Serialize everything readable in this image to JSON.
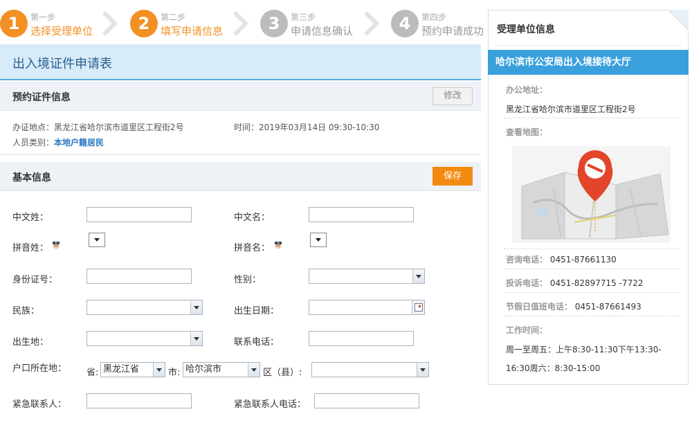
{
  "steps": [
    {
      "num": "1",
      "small": "第一步",
      "label": "选择受理单位",
      "state": "active"
    },
    {
      "num": "2",
      "small": "第二步",
      "label": "填写申请信息",
      "state": "active"
    },
    {
      "num": "3",
      "small": "第三步",
      "label": "申请信息确认",
      "state": "inactive"
    },
    {
      "num": "4",
      "small": "第四步",
      "label": "预约申请成功",
      "state": "inactive"
    }
  ],
  "page_title": "出入境证件申请表",
  "booking": {
    "header": "预约证件信息",
    "edit_label": "修改",
    "location_label": "办证地点：",
    "location_value": "黑龙江省哈尔滨市道里区工程街2号",
    "time_label": "时间：",
    "time_value": "2019年03月14日 09:30-10:30",
    "category_label": "人员类别：",
    "category_value": "本地户籍居民"
  },
  "basic": {
    "header": "基本信息",
    "save_label": "保存",
    "surname_label": "中文姓：",
    "given_label": "中文名：",
    "pinyin_surname_label": "拼音姓：",
    "pinyin_given_label": "拼音名：",
    "id_label": "身份证号：",
    "gender_label": "性别：",
    "ethnic_label": "民族：",
    "birthdate_label": "出生日期：",
    "birthplace_label": "出生地：",
    "phone_label": "联系电话：",
    "household_label": "户口所在地：",
    "province_prefix": "省:",
    "province_value": "黑龙江省",
    "city_prefix": "市:",
    "city_value": "哈尔滨市",
    "district_prefix": "区（县）:",
    "emergency_label": "紧急联系人：",
    "emergency_phone_label": "紧急联系人电话："
  },
  "sidebar": {
    "header": "受理单位信息",
    "org_name": "哈尔滨市公安局出入境接待大厅",
    "address_label": "办公地址：",
    "address_value": "黑龙江省哈尔滨市道里区工程街2号",
    "map_label": "查看地图：",
    "consult_label": "咨询电话：",
    "consult_value": "0451-87661130",
    "complaint_label": "投诉电话：",
    "complaint_value": "0451-82897715 -7722",
    "holiday_label": "节假日值班电话：",
    "holiday_value": "0451-87661493",
    "hours_label": "工作时间：",
    "hours_line1": "周一至周五：上午8:30-11:30下午13:30-",
    "hours_line2": "16:30周六：8:30-15:00"
  },
  "colors": {
    "accent_orange": "#f29024",
    "inactive_gray": "#bcbcbc",
    "title_blue": "#2a5f8d",
    "org_bar_blue": "#3aa0dc",
    "pin_red": "#e3452a"
  }
}
